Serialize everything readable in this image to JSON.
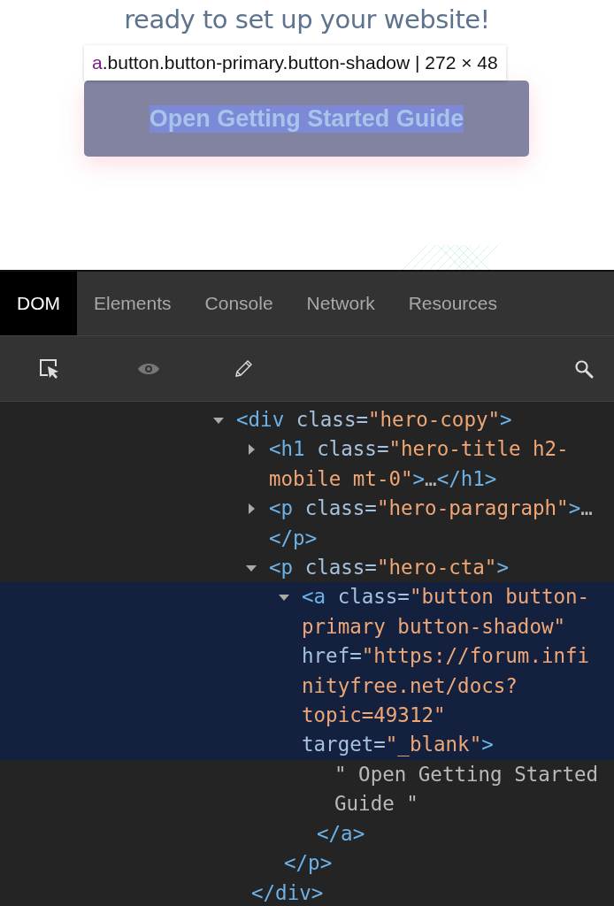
{
  "page": {
    "heading": "ready to set up your website!",
    "tooltip": {
      "tag": "a",
      "text": ".button.button-primary.button-shadow | 272 × 48"
    },
    "button": {
      "label": "Open Getting Started Guide",
      "inspected": true
    }
  },
  "tabs": [
    {
      "label": "DOM",
      "selected": true
    },
    {
      "label": "Elements",
      "selected": false
    },
    {
      "label": "Console",
      "selected": false
    },
    {
      "label": "Network",
      "selected": false
    },
    {
      "label": "Resources",
      "selected": false
    }
  ],
  "toolbar": [
    {
      "kind": "inspect",
      "disabled": false
    },
    {
      "kind": "eye",
      "disabled": true
    },
    {
      "kind": "pencil",
      "disabled": false
    },
    {
      "kind": "search",
      "disabled": false
    }
  ],
  "tree": [
    {
      "kind": "element",
      "open": "<div",
      "attributes": [
        {
          "name": "class=",
          "value": "\"hero-copy\""
        }
      ],
      "end": ">",
      "expanded": true,
      "selected": false,
      "close": "</div>",
      "children": [
        {
          "kind": "element",
          "open": "<h1",
          "attributes": [
            {
              "name": "class=",
              "value": "\"hero-title h2-mobile mt-0\""
            }
          ],
          "end": ">",
          "expanded": false,
          "selected": false,
          "ellipsis": "…",
          "close": "</h1>"
        },
        {
          "kind": "element",
          "open": "<p",
          "attributes": [
            {
              "name": "class=",
              "value": "\"hero-paragraph\""
            }
          ],
          "end": ">",
          "expanded": false,
          "selected": false,
          "ellipsis": "…",
          "close": "</p>"
        },
        {
          "kind": "element",
          "open": "<p",
          "attributes": [
            {
              "name": "class=",
              "value": "\"hero-cta\""
            }
          ],
          "end": ">",
          "expanded": true,
          "selected": false,
          "close": "</p>",
          "children": [
            {
              "kind": "element",
              "open": "<a",
              "attributes": [
                {
                  "name": "class=",
                  "value": "\"button button-primary button-shadow\""
                },
                {
                  "name": "href=",
                  "value": "\"https://forum.infinityfree.net/docs?topic=49312\""
                },
                {
                  "name": "target=",
                  "value": "\"_blank\""
                }
              ],
              "end": ">",
              "expanded": true,
              "selected": true,
              "close": "</a>",
              "children": [
                {
                  "kind": "text",
                  "text": "\" Open Getting Started Guide \""
                }
              ]
            }
          ]
        }
      ]
    }
  ]
}
